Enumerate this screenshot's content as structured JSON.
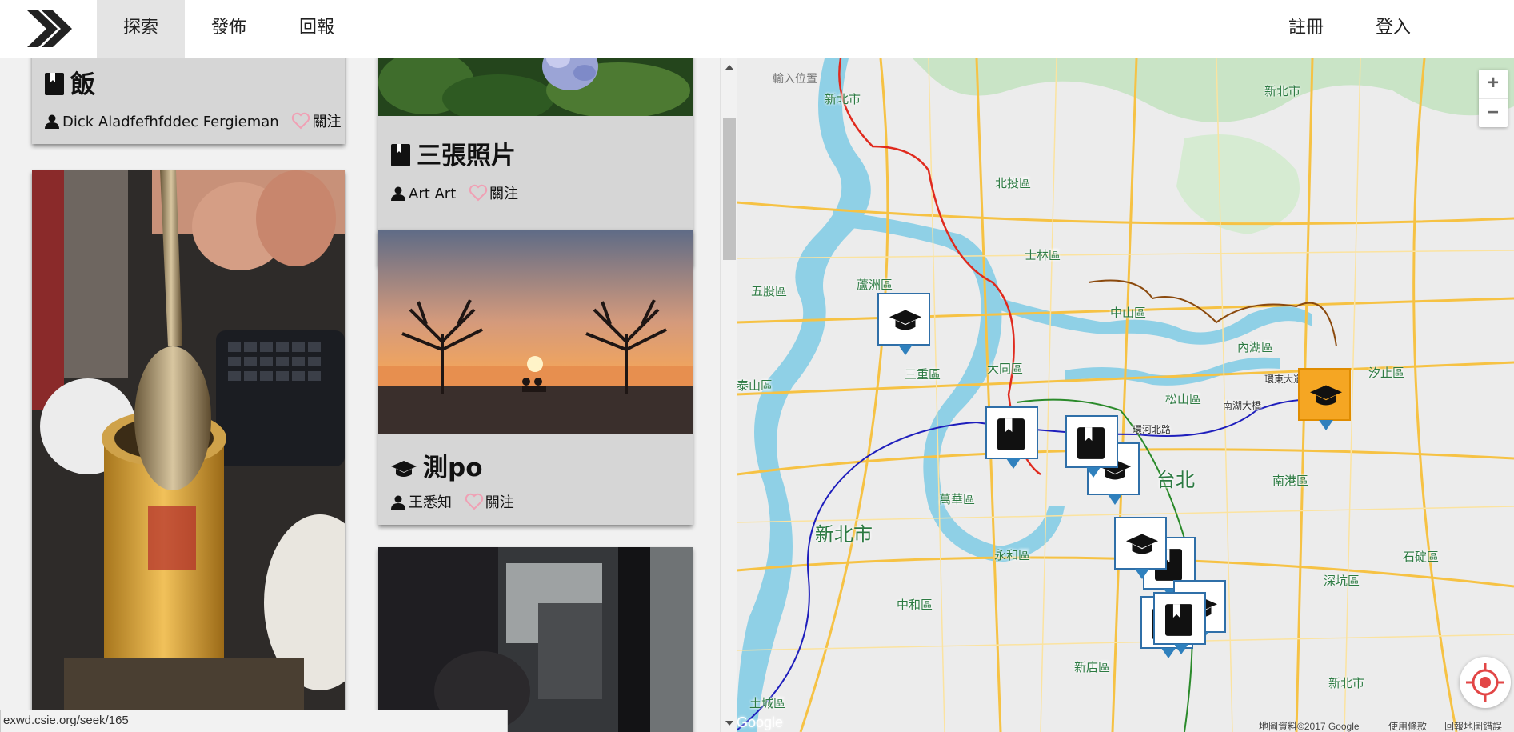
{
  "navbar": {
    "tabs": [
      {
        "label": "探索",
        "active": true
      },
      {
        "label": "發佈",
        "active": false
      },
      {
        "label": "回報",
        "active": false
      }
    ],
    "register_label": "註冊",
    "login_label": "登入"
  },
  "feed": {
    "cards": [
      {
        "title": "飯",
        "icon": "book-icon",
        "author": "Dick Aladfefhfddec Fergieman",
        "follow_label": "關注"
      },
      {
        "title": "三張照片",
        "icon": "book-icon",
        "author": "Art Art",
        "follow_label": "關注"
      },
      {
        "title": "測po",
        "icon": "graduation-cap-icon",
        "author": "王悉知",
        "follow_label": "關注"
      }
    ]
  },
  "map": {
    "search_placeholder": "輸入位置",
    "zoom_in": "+",
    "zoom_out": "−",
    "labels": {
      "xinbei_top": "新北市",
      "beitou": "北投區",
      "shilin": "士林區",
      "luzhou": "蘆洲區",
      "wugu": "五股區",
      "zhongshan": "中山區",
      "neihu": "內湖區",
      "xizhi": "汐止區",
      "sanchong": "三重區",
      "datong": "大同區",
      "songshan": "松山區",
      "taishan": "泰山區",
      "taipei": "台北",
      "nangang": "南港區",
      "wanhua": "萬華區",
      "xinbei_big": "新北市",
      "yonghe": "永和區",
      "zhonghe": "中和區",
      "shiding": "石碇區",
      "shenkeng": "深坑區",
      "xindian": "新店區",
      "tucheng": "土城區",
      "xinbei_right": "新北市",
      "xinbei_upper": "新北市"
    },
    "roads": {
      "huandong": "環東大道",
      "ring_north": "環河北路",
      "nanhu": "南湖大橋"
    },
    "footer": {
      "data": "地圖資料©2017 Google",
      "terms": "使用條款",
      "report": "回報地圖錯誤"
    },
    "google_label": "Google"
  },
  "status_bar": {
    "url": "exwd.csie.org/seek/165"
  },
  "colors": {
    "accent_orange": "#f5a623",
    "marker_blue": "#2f6fa8",
    "heart_pink": "#f0a0b4",
    "card_bg": "#d6d6d6"
  }
}
